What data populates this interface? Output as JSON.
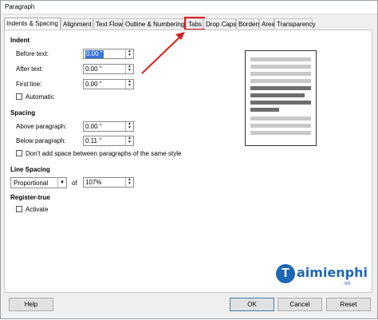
{
  "window": {
    "title": "Paragraph"
  },
  "tabs": [
    {
      "label": "Indents & Spacing"
    },
    {
      "label": "Alignment"
    },
    {
      "label": "Text Flow"
    },
    {
      "label": "Outline & Numbering"
    },
    {
      "label": "Tabs"
    },
    {
      "label": "Drop Caps"
    },
    {
      "label": "Borders"
    },
    {
      "label": "Area"
    },
    {
      "label": "Transparency"
    }
  ],
  "indent": {
    "heading": "Indent",
    "before_text": {
      "label": "Before text:",
      "value": "0.00 \""
    },
    "after_text": {
      "label": "After text:",
      "value": "0.00 \""
    },
    "first_line": {
      "label": "First line:",
      "value": "0.00 \""
    },
    "automatic": {
      "label": "Automatic",
      "checked": false
    }
  },
  "spacing": {
    "heading": "Spacing",
    "above": {
      "label": "Above paragraph:",
      "value": "0.00 \""
    },
    "below": {
      "label": "Below paragraph:",
      "value": "0.11 \""
    },
    "dont_add": {
      "label": "Don't add space between paragraphs of the same style",
      "checked": false
    }
  },
  "line_spacing": {
    "heading": "Line Spacing",
    "mode": "Proportional",
    "of_label": "of",
    "value": "107%"
  },
  "register": {
    "heading": "Register-true",
    "activate": {
      "label": "Activate",
      "checked": false
    }
  },
  "buttons": {
    "help": "Help",
    "ok": "OK",
    "cancel": "Cancel",
    "reset": "Reset"
  },
  "watermark": {
    "brand": "aimienphi",
    "letter": "T",
    "tld": ".vn"
  },
  "annotation_color": "#d91e1e",
  "accent": "#3875d7"
}
